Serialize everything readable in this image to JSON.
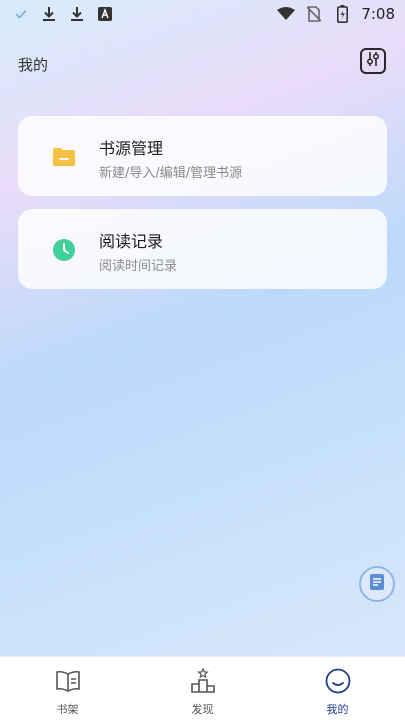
{
  "status_bar": {
    "time": "7:08",
    "left_icons": [
      "check-icon",
      "download-icon",
      "download-icon",
      "font-a-icon"
    ],
    "right_icons": [
      "wifi-icon",
      "no-sim-icon",
      "battery-charging-icon"
    ]
  },
  "header": {
    "title": "我的",
    "settings_icon": "tune-settings-icon"
  },
  "cards": [
    {
      "title": "书源管理",
      "subtitle": "新建/导入/编辑/管理书源",
      "icon": "folder-icon",
      "icon_color": "#f6c244"
    },
    {
      "title": "阅读记录",
      "subtitle": "阅读时间记录",
      "icon": "clock-icon",
      "icon_color": "#3fcf9b"
    }
  ],
  "floating_button": {
    "icon": "document-icon"
  },
  "bottom_nav": {
    "items": [
      {
        "label": "书架",
        "icon": "book-icon"
      },
      {
        "label": "发现",
        "icon": "podium-icon"
      },
      {
        "label": "我的",
        "icon": "smile-icon",
        "active": true
      }
    ]
  },
  "colors": {
    "accent": "#1f3f86",
    "card_bg": "#ffffff"
  }
}
